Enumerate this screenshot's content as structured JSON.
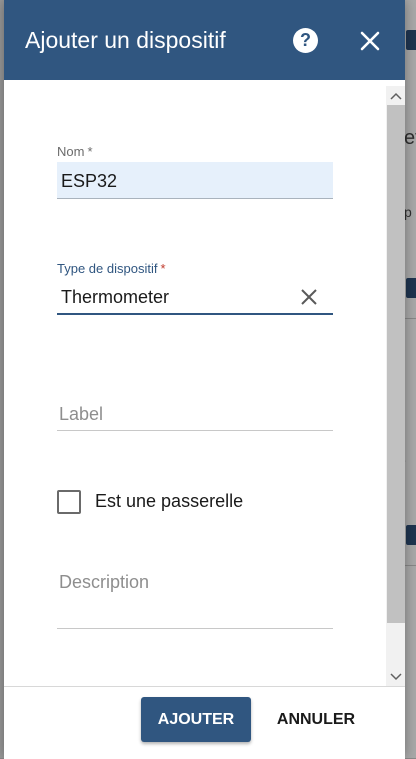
{
  "dialog": {
    "title": "Ajouter un dispositif",
    "help_glyph": "?",
    "header_color": "#305680"
  },
  "form": {
    "name": {
      "label": "Nom",
      "required_mark": "*",
      "value": "ESP32"
    },
    "device_type": {
      "label": "Type de dispositif",
      "required_mark": "*",
      "value": "Thermometer"
    },
    "label_field": {
      "placeholder": "Label"
    },
    "gateway": {
      "label": "Est une passerelle",
      "checked": false
    },
    "description": {
      "placeholder": "Description"
    }
  },
  "footer": {
    "add_label": "AJOUTER",
    "cancel_label": "ANNULER"
  },
  "background": {
    "fragment_1": "ev",
    "fragment_2": "p",
    "fragment_3": "e"
  },
  "icons": {
    "help": "help-circle-icon",
    "close": "close-icon",
    "clear": "clear-icon",
    "scroll_up": "chevron-up-icon",
    "scroll_down": "chevron-down-icon"
  }
}
